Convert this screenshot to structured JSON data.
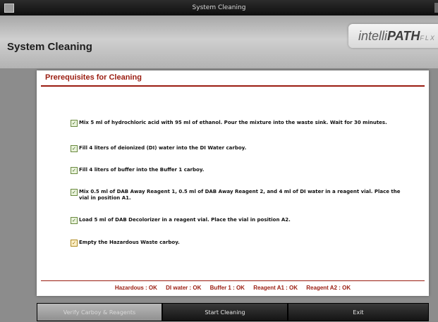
{
  "window": {
    "title": "System Cleaning"
  },
  "header": {
    "page_title": "System Cleaning",
    "logo_intelli": "intelli",
    "logo_path": "PATH",
    "logo_flx": "FLX"
  },
  "panel": {
    "title": "Prerequisites for Cleaning",
    "items": [
      "Mix 5 ml of hydrochloric acid with 95 ml of ethanol. Pour the mixture into the waste sink. Wait for 30 minutes.",
      "Fill 4 liters of deionized (DI) water into the DI Water carboy.",
      "Fill 4 liters of buffer into the Buffer 1 carboy.",
      "Mix 0.5 ml of DAB Away Reagent 1, 0.5 ml of DAB Away Reagent 2, and 4 ml of DI water in a reagent vial. Place the vial in position A1.",
      "Load 5 ml of DAB Decolorizer in a reagent vial. Place the vial in position A2.",
      "Empty the Hazardous Waste carboy."
    ],
    "checkmark": "✓",
    "status": [
      "Hazardous : OK",
      "DI water : OK",
      "Buffer 1 : OK",
      "Reagent A1 : OK",
      "Reagent A2 : OK"
    ]
  },
  "buttons": {
    "verify": "Verify Carboy & Reagents",
    "start": "Start Cleaning",
    "exit": "Exit"
  },
  "colors": {
    "accent": "#9a1c10",
    "check_green": "#6a8a40",
    "check_orange": "#b08a20"
  }
}
